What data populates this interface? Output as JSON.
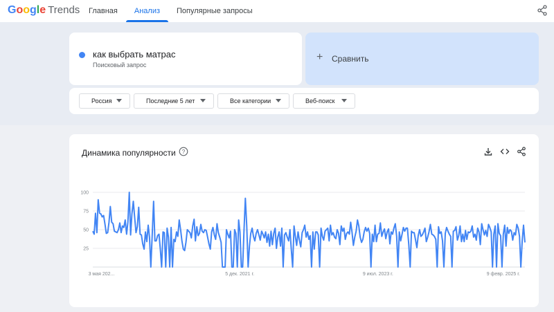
{
  "header": {
    "logo_google": "Google",
    "logo_trends": "Trends",
    "nav": [
      {
        "label": "Главная",
        "active": false
      },
      {
        "label": "Анализ",
        "active": true
      },
      {
        "label": "Популярные запросы",
        "active": false
      }
    ],
    "share_icon": "share-icon"
  },
  "search": {
    "term": "как выбрать матрас",
    "term_type": "Поисковый запрос",
    "term_color": "#4285f4",
    "compare_label": "Сравнить"
  },
  "filters": [
    {
      "label": "Россия"
    },
    {
      "label": "Последние 5 лет"
    },
    {
      "label": "Все категории"
    },
    {
      "label": "Веб-поиск"
    }
  ],
  "chart_card": {
    "title": "Динамика популярности",
    "icons": [
      "help-icon",
      "download-icon",
      "embed-icon",
      "share-icon"
    ]
  },
  "chart_data": {
    "type": "line",
    "title": "Динамика популярности",
    "y_ticks": [
      100,
      75,
      50,
      25
    ],
    "ylim": [
      0,
      100
    ],
    "x_tick_labels": [
      "3 мая 202...",
      "5 дек. 2021 г.",
      "9 июл. 2023 г.",
      "9 февр. 2025 г."
    ],
    "grid": true,
    "color": "#4285f4",
    "series": [
      {
        "values": [
          48,
          44,
          72,
          46,
          90,
          72,
          71,
          67,
          69,
          58,
          45,
          46,
          60,
          81,
          60,
          58,
          48,
          47,
          46,
          50,
          59,
          46,
          55,
          53,
          63,
          44,
          60,
          100,
          43,
          71,
          88,
          67,
          46,
          54,
          80,
          44,
          43,
          31,
          24,
          47,
          34,
          56,
          40,
          0,
          43,
          88,
          35,
          35,
          42,
          44,
          24,
          0,
          47,
          46,
          0,
          52,
          40,
          0,
          53,
          0,
          37,
          34,
          47,
          41,
          63,
          50,
          35,
          24,
          22,
          33,
          50,
          48,
          46,
          39,
          55,
          64,
          35,
          54,
          42,
          45,
          57,
          48,
          46,
          50,
          49,
          40,
          31,
          24,
          47,
          53,
          43,
          37,
          58,
          46,
          40,
          33,
          0,
          0,
          0,
          50,
          44,
          39,
          48,
          0,
          0,
          50,
          45,
          0,
          63,
          47,
          0,
          0,
          50,
          92,
          55,
          0,
          28,
          45,
          52,
          41,
          35,
          45,
          50,
          43,
          36,
          48,
          44,
          39,
          47,
          33,
          44,
          28,
          48,
          30,
          45,
          52,
          25,
          40,
          47,
          28,
          52,
          0,
          43,
          46,
          40,
          35,
          50,
          24,
          0,
          55,
          41,
          29,
          47,
          36,
          27,
          46,
          50,
          56,
          40,
          47,
          37,
          42,
          0,
          47,
          24,
          47,
          47,
          43,
          0,
          52,
          41,
          36,
          48,
          50,
          52,
          35,
          56,
          43,
          46,
          40,
          38,
          50,
          45,
          30,
          55,
          48,
          52,
          37,
          45,
          47,
          44,
          60,
          46,
          29,
          40,
          48,
          63,
          55,
          40,
          33,
          37,
          47,
          53,
          48,
          52,
          45,
          0,
          44,
          34,
          56,
          34,
          44,
          45,
          59,
          41,
          47,
          51,
          38,
          47,
          51,
          31,
          47,
          44,
          52,
          58,
          41,
          0,
          47,
          35,
          44,
          53,
          48,
          52,
          52,
          30,
          0,
          48,
          46,
          46,
          36,
          26,
          42,
          50,
          41,
          43,
          47,
          52,
          34,
          40,
          47,
          57,
          44,
          43,
          41,
          37,
          0,
          54,
          45,
          47,
          35,
          0,
          45,
          53,
          48,
          44,
          41,
          0,
          48,
          49,
          54,
          36,
          42,
          55,
          34,
          44,
          34,
          49,
          37,
          47,
          46,
          48,
          55,
          40,
          44,
          36,
          52,
          47,
          30,
          58,
          50,
          43,
          49,
          41,
          57,
          53,
          47,
          0,
          44,
          55,
          0,
          58,
          45,
          42,
          0,
          44,
          56,
          28,
          53,
          45,
          50,
          48,
          36,
          46,
          43,
          57,
          52,
          41,
          0,
          35,
          56,
          33
        ]
      }
    ]
  }
}
